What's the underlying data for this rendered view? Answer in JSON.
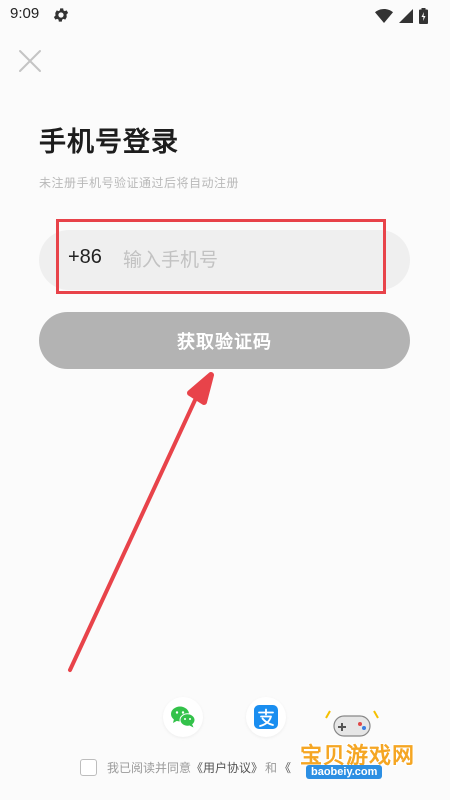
{
  "status_bar": {
    "time": "9:09",
    "icons": [
      "gear-icon",
      "wifi-icon",
      "signal-icon",
      "battery-icon"
    ]
  },
  "header": {
    "close_icon": "close-icon"
  },
  "login": {
    "title": "手机号登录",
    "subtitle": "未注册手机号验证通过后将自动注册",
    "country_code": "+86",
    "phone_placeholder": "输入手机号",
    "phone_value": "",
    "code_button_label": "获取验证码"
  },
  "social": {
    "items": [
      {
        "name": "wechat",
        "icon": "wechat-icon",
        "color": "#33c24a"
      },
      {
        "name": "alipay",
        "icon": "alipay-icon",
        "color": "#1a8ef0"
      }
    ]
  },
  "agreement": {
    "prefix": "我已阅读并同意",
    "user_agreement": "《用户协议》",
    "and": "和",
    "privacy_policy": "《"
  },
  "watermark": {
    "text": "宝贝游戏网",
    "url": "baobeiy.com"
  },
  "colors": {
    "background": "#fbfbfb",
    "input_bg": "#efefef",
    "button_disabled": "#b3b3b3",
    "highlight": "#e8434a",
    "watermark_orange": "#f5a623",
    "watermark_blue": "#2c8fe3"
  }
}
